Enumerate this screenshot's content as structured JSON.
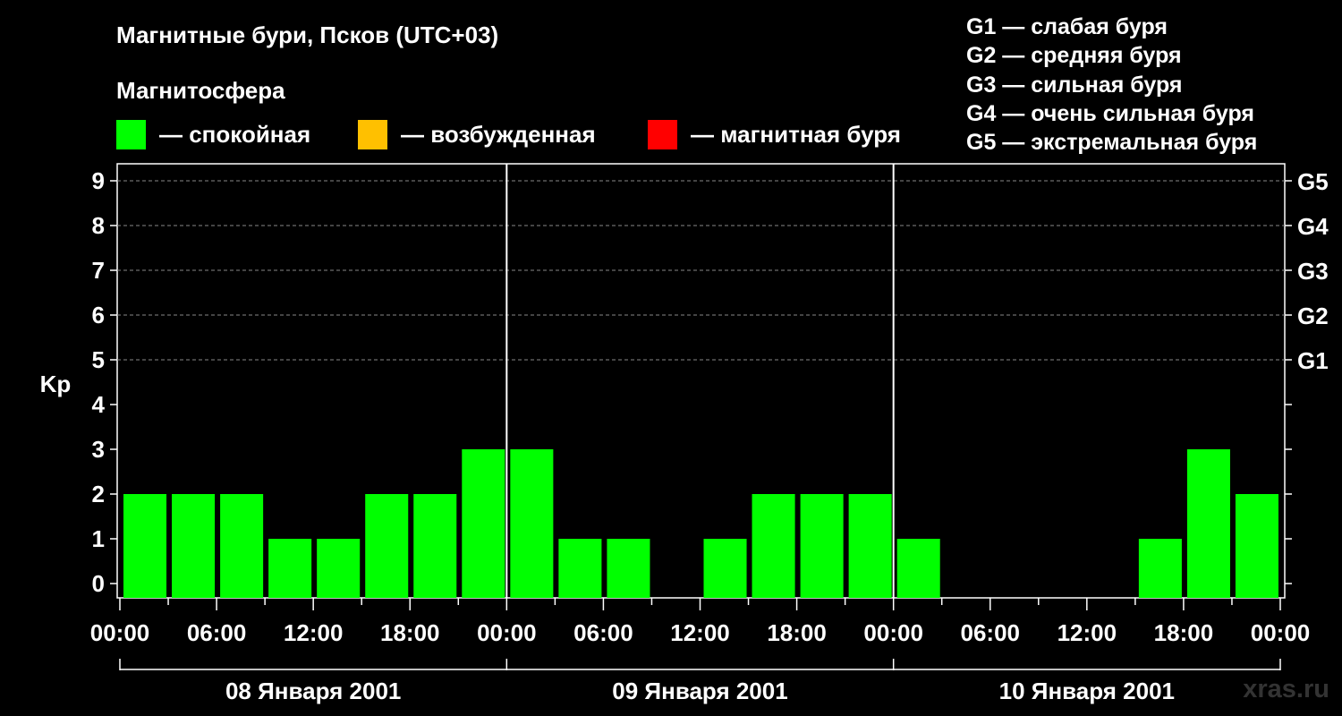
{
  "title": "Магнитные бури, Псков (UTC+03)",
  "subtitle": "Магнитосфера",
  "legend": [
    {
      "label": "— спокойная",
      "color": "#00ff00"
    },
    {
      "label": "— возбужденная",
      "color": "#ffc000"
    },
    {
      "label": "— магнитная буря",
      "color": "#ff0000"
    }
  ],
  "g_legend": [
    "G1 — слабая буря",
    "G2 — средняя буря",
    "G3 — сильная буря",
    "G4 — очень сильная буря",
    "G5 — экстремальная буря"
  ],
  "watermark": "xras.ru",
  "chart_data": {
    "type": "bar",
    "ylabel": "Kp",
    "ylim": [
      0,
      9
    ],
    "y_ticks": [
      "0",
      "1",
      "2",
      "3",
      "4",
      "5",
      "6",
      "7",
      "8",
      "9"
    ],
    "right_ticks": [
      {
        "value": 5,
        "label": "G1"
      },
      {
        "value": 6,
        "label": "G2"
      },
      {
        "value": 7,
        "label": "G3"
      },
      {
        "value": 8,
        "label": "G4"
      },
      {
        "value": 9,
        "label": "G5"
      }
    ],
    "x_tick_labels": [
      "00:00",
      "06:00",
      "12:00",
      "18:00",
      "00:00",
      "06:00",
      "12:00",
      "18:00",
      "00:00",
      "06:00",
      "12:00",
      "18:00",
      "00:00"
    ],
    "days": [
      "08 Января 2001",
      "09 Января 2001",
      "10 Января 2001"
    ],
    "interval_hours": 3,
    "values": [
      2,
      2,
      2,
      1,
      1,
      2,
      2,
      3,
      3,
      1,
      1,
      0,
      1,
      2,
      2,
      2,
      1,
      0,
      0,
      0,
      0,
      1,
      3,
      2
    ],
    "grid": "dashed horizontal at 5–9"
  }
}
